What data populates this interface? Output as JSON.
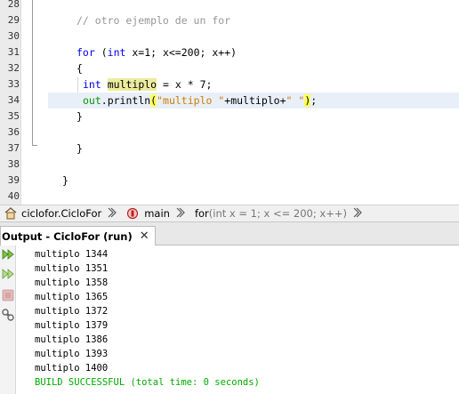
{
  "editor": {
    "line_numbers": [
      "28",
      "29",
      "30",
      "31",
      "32",
      "33",
      "34",
      "35",
      "36",
      "37",
      "38",
      "39",
      "40"
    ],
    "comment": "// otro ejemplo de un for",
    "for_line": {
      "kw_for": "for",
      "open": " (",
      "kw_int": "int",
      "rest": " x=1; x<=200; x++)"
    },
    "open_brace": "{",
    "decl_line": {
      "kw_int": "int",
      "space": " ",
      "var": "multiplo",
      "rest": " = x * 7;"
    },
    "print_line": {
      "field": "out",
      "call": ".println",
      "paren_open": "(",
      "str1": "\"multiplo \"",
      "concat": "+multiplo+",
      "str2": "\" \"",
      "paren_close": ")",
      "semi": ";"
    },
    "close_brace": "}",
    "outer_close": "}",
    "class_close": "}"
  },
  "breadcrumb": {
    "file": "ciclofor.CicloFor",
    "method": "main",
    "loop_kw": "for",
    "loop_detail": " (int x = 1; x <= 200; x++)"
  },
  "output": {
    "tab_title": "Output - CicloFor (run)",
    "close_glyph": "✕",
    "lines": [
      "multiplo 1344",
      "multiplo 1351",
      "multiplo 1358",
      "multiplo 1365",
      "multiplo 1372",
      "multiplo 1379",
      "multiplo 1386",
      "multiplo 1393",
      "multiplo 1400"
    ],
    "status": "BUILD SUCCESSFUL (total time: 0 seconds)"
  },
  "colors": {
    "keyword": "#0000e6",
    "comment": "#969696",
    "string": "#ce7b00",
    "field": "#009900",
    "success": "#00aa00",
    "current_line": "#e9eff8",
    "mark_occurrence": "#ecec9e",
    "brace_match": "#ffff5c"
  },
  "icons": [
    "package-icon",
    "method-icon",
    "chevron-right-icon",
    "close-icon",
    "rerun-icon",
    "rerun-different-icon",
    "stop-icon",
    "settings-icon"
  ]
}
